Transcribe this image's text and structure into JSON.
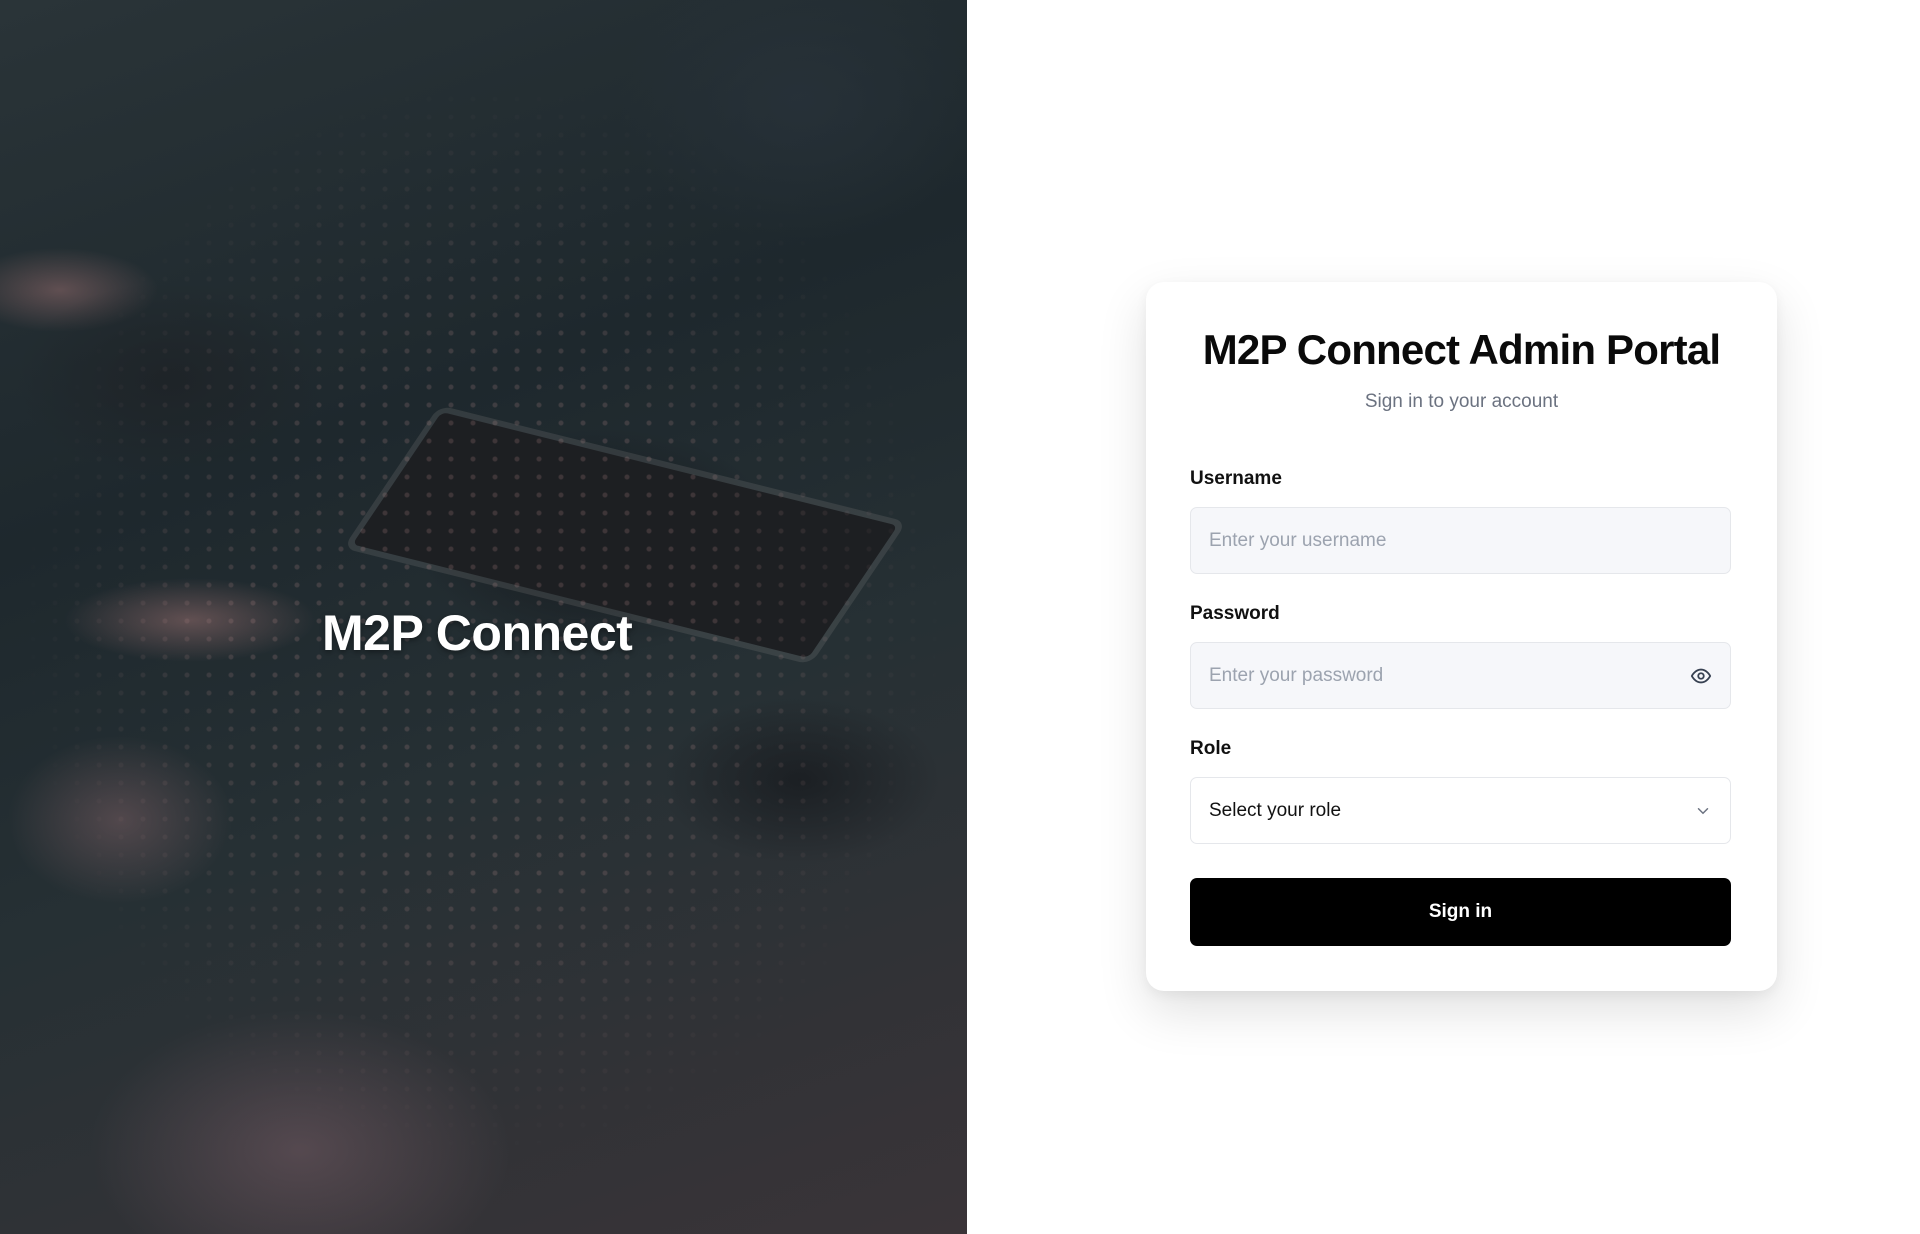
{
  "hero": {
    "title": "M2P Connect"
  },
  "card": {
    "title": "M2P Connect Admin Portal",
    "subtitle": "Sign in to your account",
    "username": {
      "label": "Username",
      "placeholder": "Enter your username",
      "value": ""
    },
    "password": {
      "label": "Password",
      "placeholder": "Enter your password",
      "value": "",
      "toggle_icon": "eye-icon"
    },
    "role": {
      "label": "Role",
      "selected": "Select your role",
      "icon": "chevron-down-icon"
    },
    "submit_label": "Sign in"
  },
  "colors": {
    "button": "#000000",
    "input_bg": "#f6f7fa",
    "subtitle": "#6b7280"
  }
}
